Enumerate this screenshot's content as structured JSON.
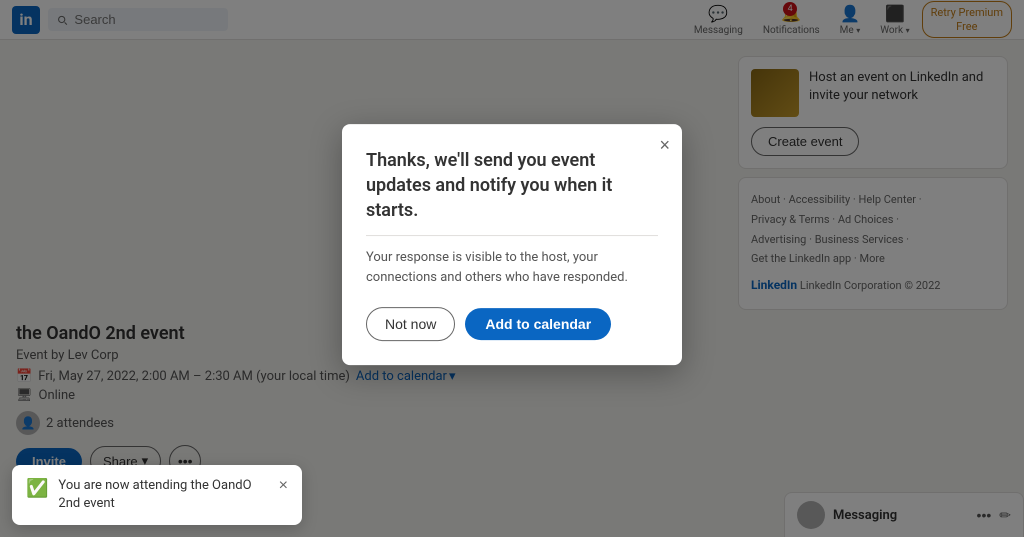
{
  "header": {
    "logo_text": "in",
    "search_placeholder": "Search",
    "nav_items": [
      {
        "label": "Messaging",
        "icon": "💬",
        "badge": null
      },
      {
        "label": "Notifications",
        "icon": "🔔",
        "badge": "4"
      },
      {
        "label": "Me",
        "icon": "👤",
        "badge": null
      },
      {
        "label": "Work",
        "icon": "⬛",
        "badge": null
      }
    ],
    "premium_line1": "Retry Premium",
    "premium_line2": "Free"
  },
  "event": {
    "title": "the OandO 2nd event",
    "by_label": "Event by Lev Corp",
    "date": "Fri, May 27, 2022, 2:00 AM – 2:30 AM (your local time)",
    "add_to_calendar_label": "Add to calendar",
    "location": "Online",
    "attendees_count": "2 attendees",
    "invite_label": "Invite",
    "share_label": "Share",
    "share_arrow": "▾"
  },
  "sidebar": {
    "host_text": "Host an event on LinkedIn and invite your network",
    "create_event_label": "Create event",
    "footer_links": [
      "About",
      "Accessibility",
      "Help Center",
      "Privacy & Terms",
      "Ad Choices",
      "Advertising",
      "Business Services",
      "Get the LinkedIn app",
      "More"
    ],
    "copyright": "LinkedIn Corporation © 2022"
  },
  "dialog": {
    "title": "Thanks, we'll send you event updates and notify you when it starts.",
    "body": "Your response is visible to the host, your connections and others who have responded.",
    "not_now_label": "Not now",
    "add_calendar_label": "Add to calendar",
    "close_icon": "×"
  },
  "toast": {
    "message": "You are now attending the OandO 2nd event",
    "close_icon": "×"
  },
  "messaging": {
    "label": "Messaging"
  }
}
